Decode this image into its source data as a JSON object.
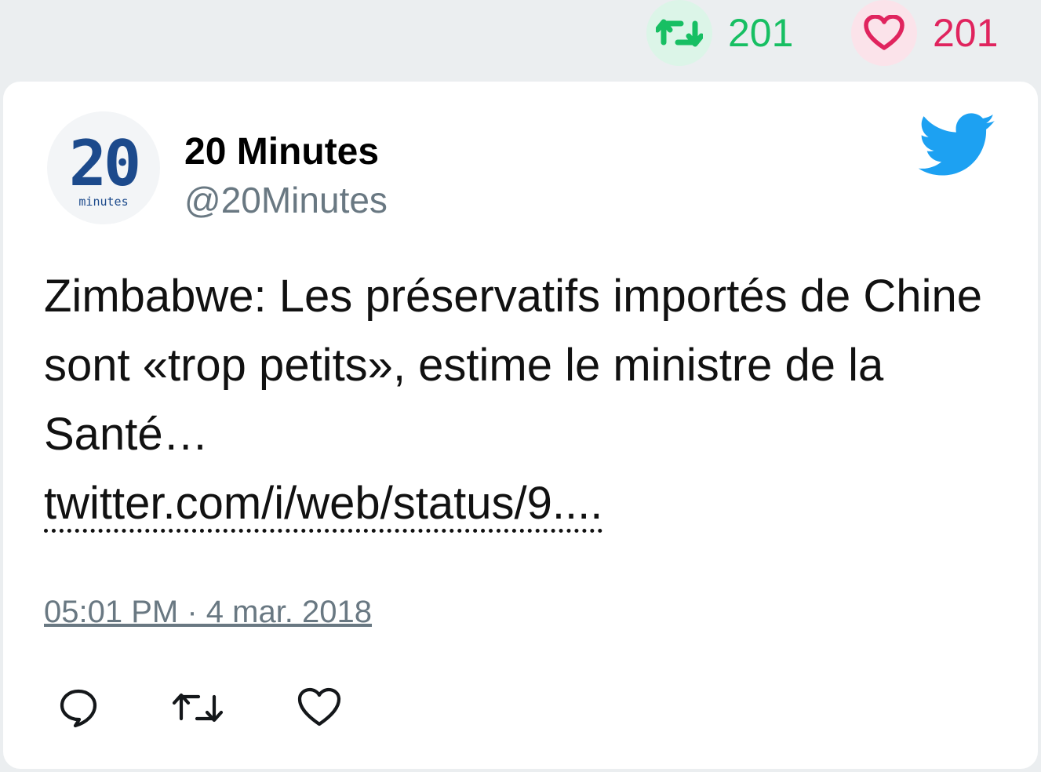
{
  "stats": {
    "retweet_count": "201",
    "like_count": "201",
    "retweet_color": "#17bf63",
    "like_color": "#e0245e"
  },
  "author": {
    "display_name": "20 Minutes",
    "handle": "@20Minutes",
    "logo_number": "20",
    "logo_word": "minutes",
    "logo_color": "#1c4a8c"
  },
  "tweet": {
    "text": "Zimbabwe: Les préservatifs importés de Chine sont «trop petits», estime le ministre de la Santé…",
    "link": "twitter.com/i/web/status/9....",
    "timestamp": "05:01 PM · 4 mar. 2018"
  },
  "icons": {
    "brand": "twitter-bird-icon",
    "reply": "reply-icon",
    "retweet": "retweet-icon",
    "like": "heart-icon"
  },
  "brand_color": "#1da1f2"
}
